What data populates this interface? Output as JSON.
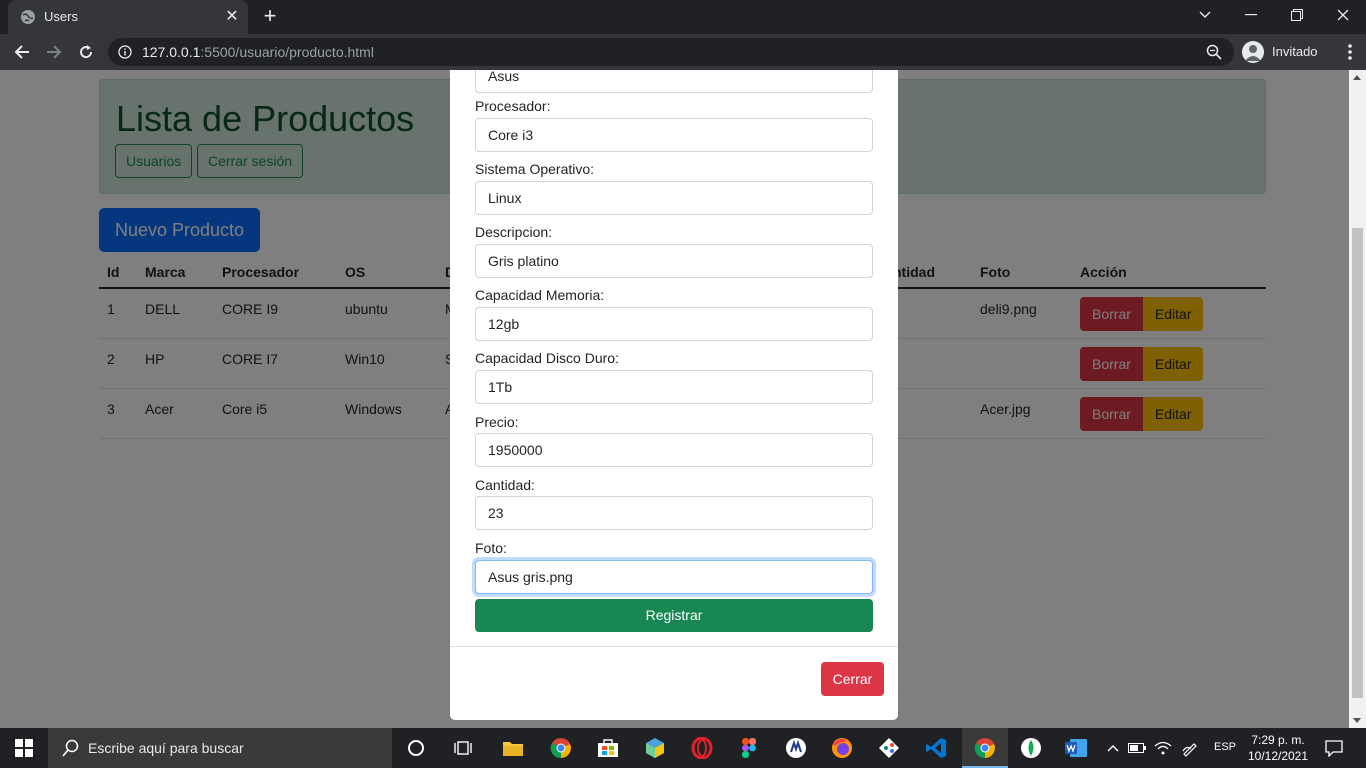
{
  "browser": {
    "tab_title": "Users",
    "url_host": "127.0.0.1",
    "url_path": ":5500/usuario/producto.html",
    "profile_label": "Invitado"
  },
  "page": {
    "title": "Lista de Productos",
    "btn_usuarios": "Usuarios",
    "btn_cerrar_sesion": "Cerrar sesión",
    "btn_nuevo": "Nuevo Producto",
    "columns": [
      "Id",
      "Marca",
      "Procesador",
      "OS",
      "D",
      "ntidad",
      "Foto",
      "Acción"
    ],
    "rows": [
      {
        "id": "1",
        "marca": "DELL",
        "procesador": "CORE I9",
        "os": "ubuntu",
        "d": "M",
        "foto": "deli9.png"
      },
      {
        "id": "2",
        "marca": "HP",
        "procesador": "CORE I7",
        "os": "Win10",
        "d": "S",
        "foto": ""
      },
      {
        "id": "3",
        "marca": "Acer",
        "procesador": "Core i5",
        "os": "Windows",
        "d": "A",
        "foto": "Acer.jpg"
      }
    ],
    "btn_borrar": "Borrar",
    "btn_editar": "Editar"
  },
  "modal": {
    "marca_value": "Asus",
    "procesador_label": "Procesador:",
    "procesador_value": "Core i3",
    "so_label": "Sistema Operativo:",
    "so_value": "Linux",
    "descripcion_label": "Descripcion:",
    "descripcion_value": "Gris platino",
    "memoria_label": "Capacidad Memoria:",
    "memoria_value": "12gb",
    "disco_label": "Capacidad Disco Duro:",
    "disco_value": "1Tb",
    "precio_label": "Precio:",
    "precio_value": "1950000",
    "cantidad_label": "Cantidad:",
    "cantidad_value": "23",
    "foto_label": "Foto:",
    "foto_value": "Asus gris.png",
    "submit_label": "Registrar",
    "close_label": "Cerrar"
  },
  "taskbar": {
    "search_placeholder": "Escribe aquí para buscar",
    "language": "ESP",
    "time": "7:29 p. m.",
    "date": "10/12/2021"
  },
  "colors": {
    "primary": "#0d6efd",
    "success": "#198754",
    "danger": "#dc3545",
    "warning": "#ffc107"
  }
}
